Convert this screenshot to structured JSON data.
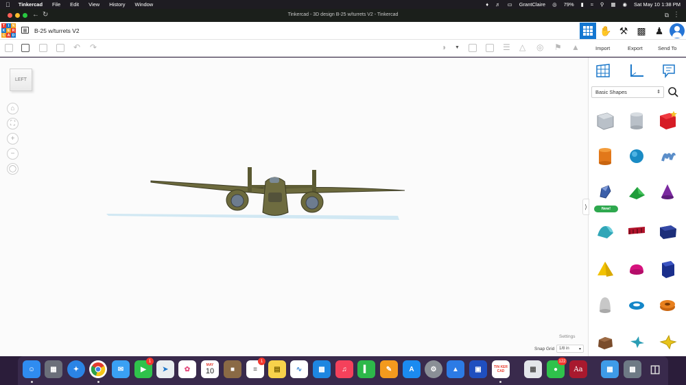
{
  "menubar": {
    "apple": "",
    "app_name": "Tinkercad",
    "menus": [
      "File",
      "Edit",
      "View",
      "History",
      "Window"
    ],
    "user": "GrantClaire",
    "battery": "79%",
    "datetime": "Sat May 10  1:38 PM"
  },
  "browser": {
    "window_title": "Tinkercad - 3D design B-25 w/turrets V2 - Tinkercad"
  },
  "app": {
    "logo_letters": [
      "T",
      "I",
      "N",
      "K",
      "E",
      "R",
      "C",
      "A",
      "D"
    ],
    "logo_colors": [
      "#e8392b",
      "#1a77c9",
      "#f3a520",
      "#1a77c9",
      "#f3a520",
      "#e8392b",
      "#f3a520",
      "#e8392b",
      "#1a77c9"
    ],
    "design_name": "B-25 w/turrets V2"
  },
  "toolbar": {
    "import_label": "Import",
    "export_label": "Export",
    "send_to_label": "Send To"
  },
  "workplane": {
    "view_cube_label": "LEFT",
    "settings_label": "Settings",
    "snap_grid_label": "Snap Grid",
    "snap_grid_value": "1/8 in"
  },
  "panel": {
    "shape_category": "Basic Shapes",
    "new_badge": "New!"
  },
  "dock": {
    "calendar_month": "MAY",
    "calendar_day": "10",
    "facetime_badge": "1",
    "reminders_badge": "1",
    "messages_badge": "122",
    "dictionary_label": "Aa",
    "tinkercad_letters": "TIN KER CAD"
  }
}
